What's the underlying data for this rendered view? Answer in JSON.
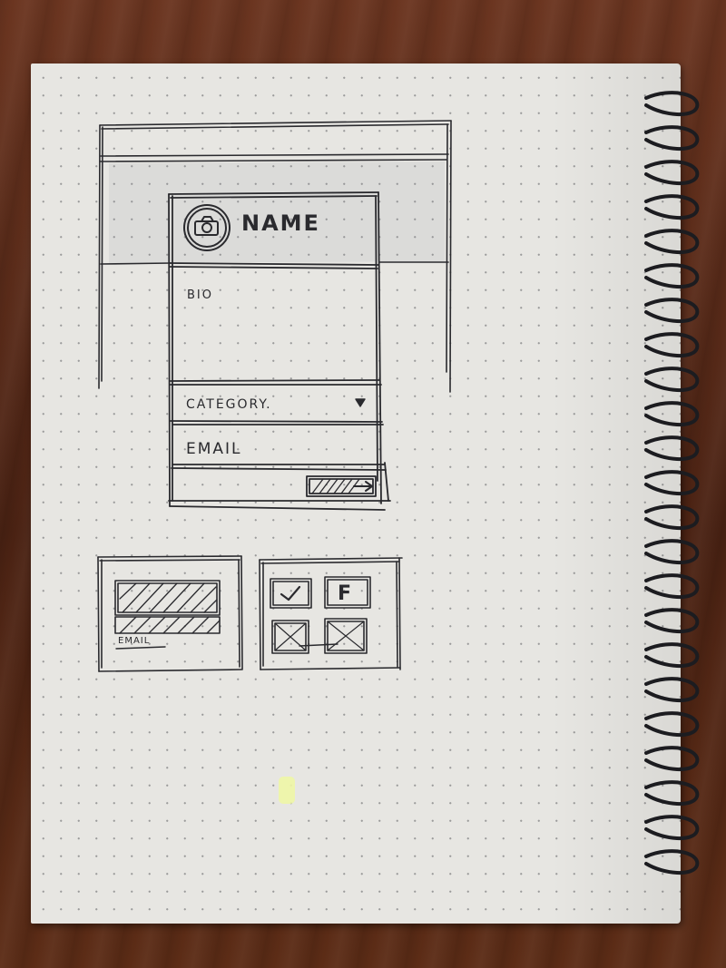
{
  "sketch": {
    "profile_card": {
      "name_label": "NAME",
      "bio_label": "BIO",
      "category_label": "CATEGORY.",
      "email_label": "EMAIL"
    },
    "thumbnail_left": {
      "email_label": "EMAIL"
    },
    "thumbnail_right": {
      "facebook_label": "F"
    }
  },
  "colors": {
    "ink": "#2a2a2e",
    "paper": "#e7e6e2",
    "desk": "#5a2d18",
    "highlighter": "#eef6a6"
  }
}
